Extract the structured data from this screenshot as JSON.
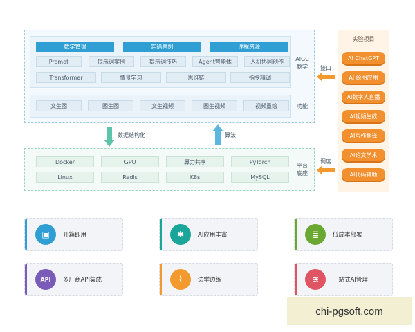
{
  "aigc": {
    "tabs": [
      "教学管理",
      "实操案例",
      "课程资源"
    ],
    "row1": [
      "Promot",
      "提示词案例",
      "提示词技巧",
      "Agent智能体",
      "人机协同创作"
    ],
    "row2": [
      "Transformer",
      "情景学习",
      "思维链",
      "指令精调"
    ],
    "label_line1": "AIGC",
    "label_line2": "教学",
    "func_cells": [
      "文生图",
      "图生图",
      "文生视频",
      "图生视频",
      "视频重绘"
    ],
    "func_label": "功能"
  },
  "platform": {
    "row1": [
      "Docker",
      "GPU",
      "算力共享",
      "PyTorch"
    ],
    "row2": [
      "Linux",
      "Redis",
      "K8s",
      "MySQL"
    ],
    "label_line1": "平台",
    "label_line2": "底座"
  },
  "lab": {
    "title": "实验项目",
    "items": [
      "AI ChatGPT",
      "AI 绘图应用",
      "AI数字人直播",
      "AI视频生成",
      "AI写作翻译",
      "AI论文学术",
      "AI代码辅助"
    ]
  },
  "flows": {
    "interface": "接口",
    "structuring": "数据结构化",
    "algorithm": "算法",
    "scheduling": "调度"
  },
  "features": [
    {
      "label": "开箱即用",
      "icon": "box-icon",
      "color": "#2f9fd3",
      "glyph": "▣"
    },
    {
      "label": "AI应用丰富",
      "icon": "flower-icon",
      "color": "#1aa59a",
      "glyph": "✱"
    },
    {
      "label": "低成本部署",
      "icon": "database-icon",
      "color": "#6aa832",
      "glyph": "≣"
    },
    {
      "label": "多厂商API集成",
      "icon": "api-cloud-icon",
      "color": "#7a5bb8",
      "glyph": "API"
    },
    {
      "label": "边学边练",
      "icon": "chart-icon",
      "color": "#f29a2e",
      "glyph": "⌇"
    },
    {
      "label": "一站式AI管理",
      "icon": "layers-icon",
      "color": "#e05563",
      "glyph": "≋"
    }
  ],
  "watermark": "chi-pgsoft.com"
}
